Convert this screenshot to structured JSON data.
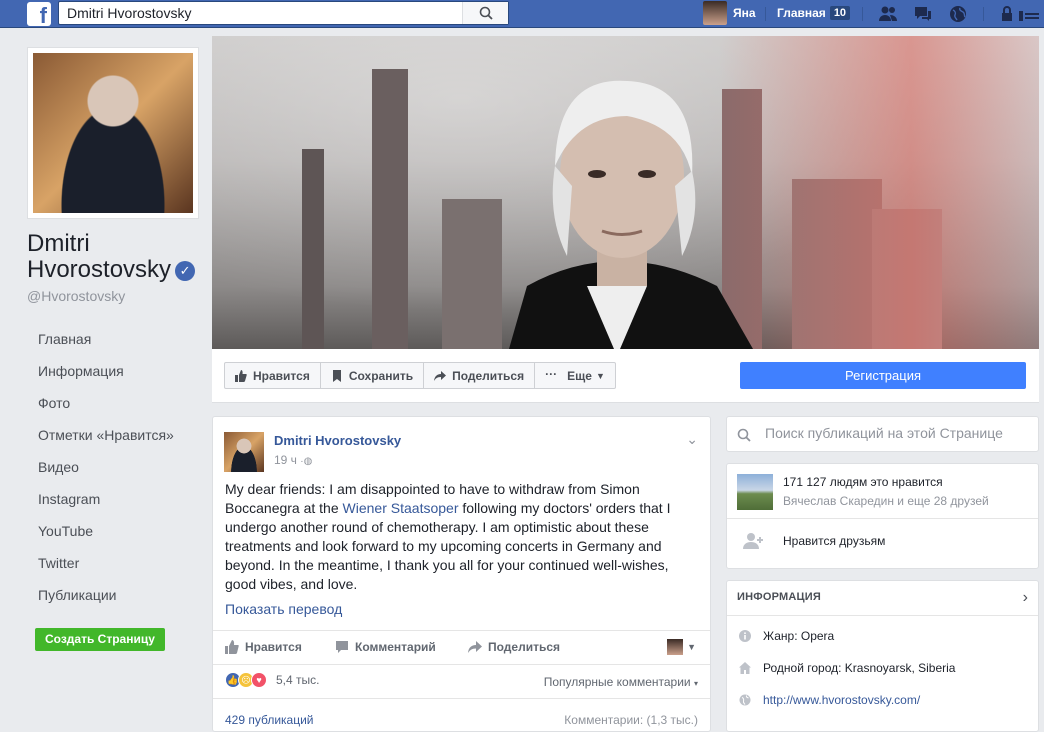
{
  "topbar": {
    "search_value": "Dmitri Hvorostovsky",
    "user_name": "Яна",
    "home_label": "Главная",
    "home_count": "10"
  },
  "sidebar": {
    "page_name": "Dmitri Hvorostovsky",
    "handle": "@Hvorostovsky",
    "nav": [
      "Главная",
      "Информация",
      "Фото",
      "Отметки «Нравится»",
      "Видео",
      "Instagram",
      "YouTube",
      "Twitter",
      "Публикации"
    ],
    "create_page": "Создать Страницу"
  },
  "actions": {
    "like": "Нравится",
    "save": "Сохранить",
    "share": "Поделиться",
    "more": "Еще",
    "register": "Регистрация"
  },
  "post": {
    "author": "Dmitri Hvorostovsky",
    "time": "19 ч",
    "text_before": "My dear friends: I am disappointed to have to withdraw from Simon Boccanegra at the ",
    "text_link": "Wiener Staatsoper",
    "text_after": " following my doctors' orders that I undergo another round of chemotherapy. I am optimistic about these treatments and look forward to my upcoming concerts in Germany and beyond. In the meantime, I thank you all for your continued well-wishes, good vibes, and love.",
    "translate": "Показать перевод",
    "like": "Нравится",
    "comment": "Комментарий",
    "share": "Поделиться",
    "reactions_count": "5,4 тыс.",
    "popular_comments": "Популярные комментарии",
    "publications": "429 публикаций",
    "comments_count": "Комментарии: (1,3 тыс.)"
  },
  "right": {
    "search_placeholder": "Поиск публикаций на этой Странице",
    "likes_count": "171 127 людям это нравится",
    "likes_friends": "Вячеслав Скаредин и еще 28 друзей",
    "friends_like": "Нравится друзьям",
    "info_title": "ИНФОРМАЦИЯ",
    "genre": "Жанр: Opera",
    "hometown": "Родной город: Krasnoyarsk, Siberia",
    "website": "http://www.hvorostovsky.com/"
  },
  "colors": {
    "brand": "#4267b2",
    "register": "#4080ff",
    "create": "#42b72a",
    "link": "#365899"
  }
}
